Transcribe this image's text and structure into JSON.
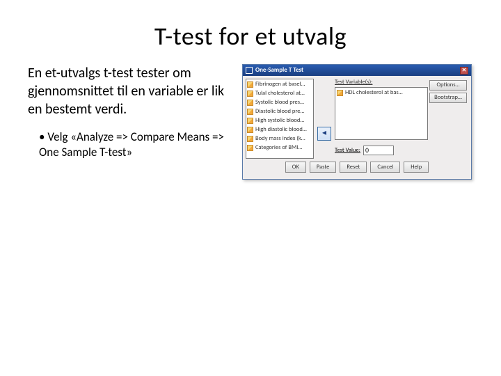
{
  "title": "T-test for et utvalg",
  "lead": "En et-utvalgs t-test tester om gjennomsnittet til en variable er lik en bestemt verdi.",
  "bullet1": "Velg «Analyze => Compare Means => One Sample T-test»",
  "dialog": {
    "title": "One-Sample T Test",
    "close": "✕",
    "source_items": [
      "Fibrinogen at basel…",
      "Tulal cholesterol at…",
      "Systolic blood pres…",
      "Diastolic blood pre…",
      "High systolic blood…",
      "High diastolic blood…",
      "Body mass index (k…",
      "Categories of BMI…"
    ],
    "test_var_label": "Test Variable(s):",
    "test_var_item": "HDL cholesterol at bas…",
    "move": "◂",
    "testvalue_label": "Test Value:",
    "testvalue": "0",
    "side": {
      "options": "Options…",
      "bootstrap": "Bootstrap…"
    },
    "btns": {
      "ok": "OK",
      "paste": "Paste",
      "reset": "Reset",
      "cancel": "Cancel",
      "help": "Help"
    }
  }
}
